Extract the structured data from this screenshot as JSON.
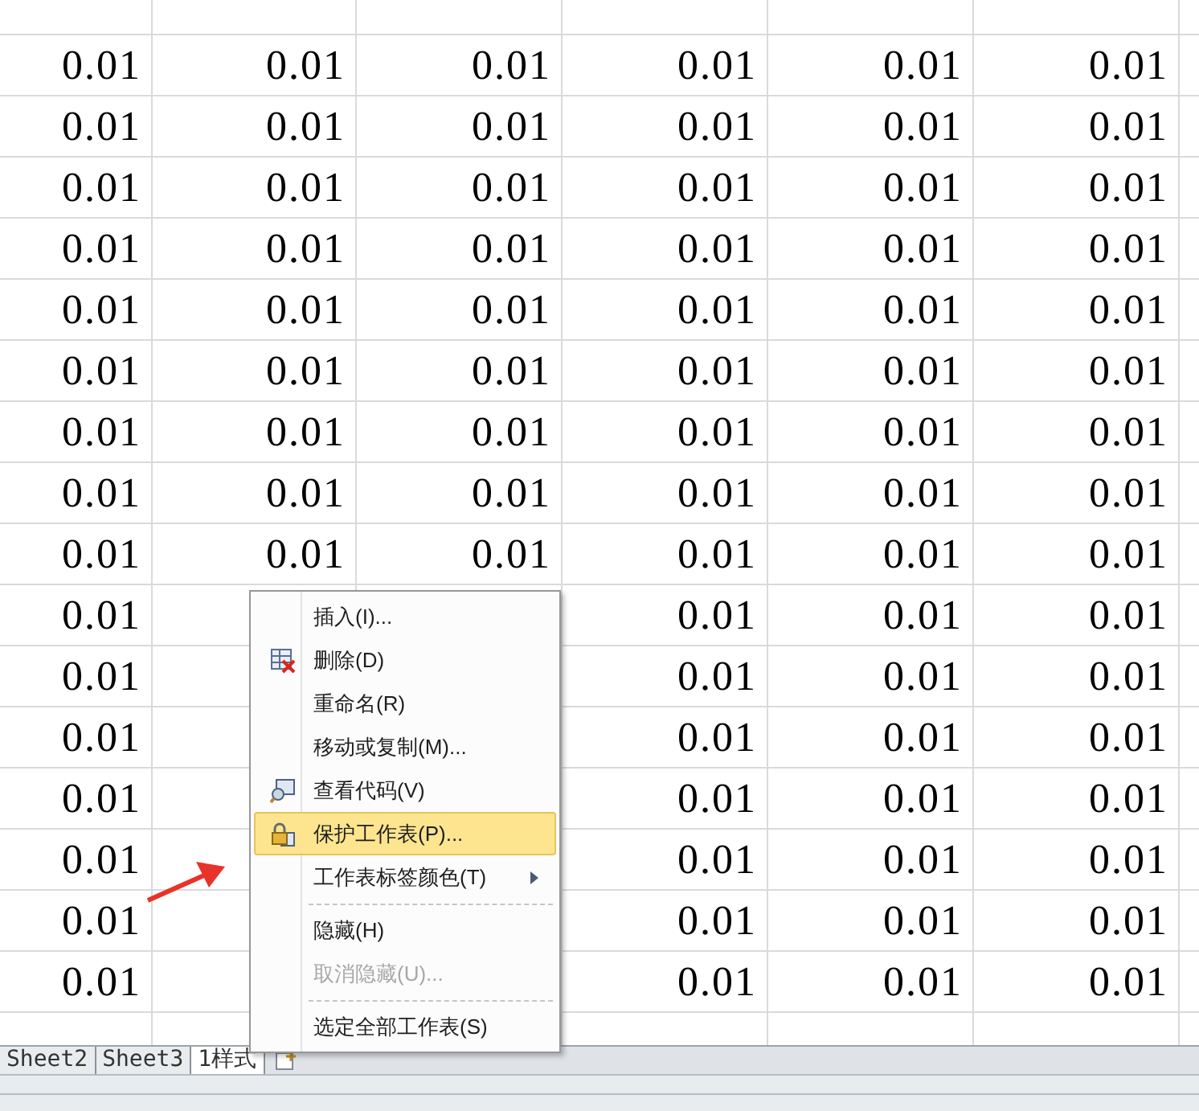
{
  "sheet": {
    "rows": [
      {
        "cells": [
          "0.01",
          "0.01",
          "0.01",
          "0.01",
          "0.01",
          "0.01"
        ]
      },
      {
        "cells": [
          "0.01",
          "0.01",
          "0.01",
          "0.01",
          "0.01",
          "0.01"
        ]
      },
      {
        "cells": [
          "0.01",
          "0.01",
          "0.01",
          "0.01",
          "0.01",
          "0.01"
        ]
      },
      {
        "cells": [
          "0.01",
          "0.01",
          "0.01",
          "0.01",
          "0.01",
          "0.01"
        ]
      },
      {
        "cells": [
          "0.01",
          "0.01",
          "0.01",
          "0.01",
          "0.01",
          "0.01"
        ]
      },
      {
        "cells": [
          "0.01",
          "0.01",
          "0.01",
          "0.01",
          "0.01",
          "0.01"
        ]
      },
      {
        "cells": [
          "0.01",
          "0.01",
          "0.01",
          "0.01",
          "0.01",
          "0.01"
        ]
      },
      {
        "cells": [
          "0.01",
          "0.01",
          "0.01",
          "0.01",
          "0.01",
          "0.01"
        ]
      },
      {
        "cells": [
          "0.01",
          "0.01",
          "0.01",
          "0.01",
          "0.01",
          "0.01"
        ]
      },
      {
        "cells": [
          "0.01",
          null,
          null,
          "0.01",
          "0.01",
          "0.01"
        ]
      },
      {
        "cells": [
          "0.01",
          null,
          null,
          "0.01",
          "0.01",
          "0.01"
        ]
      },
      {
        "cells": [
          "0.01",
          null,
          null,
          "0.01",
          "0.01",
          "0.01"
        ]
      },
      {
        "cells": [
          "0.01",
          null,
          null,
          "0.01",
          "0.01",
          "0.01"
        ]
      },
      {
        "cells": [
          "0.01",
          null,
          null,
          "0.01",
          "0.01",
          "0.01"
        ]
      },
      {
        "cells": [
          "0.01",
          null,
          null,
          "0.01",
          "0.01",
          "0.01"
        ]
      },
      {
        "cells": [
          "0.01",
          null,
          null,
          "0.01",
          "0.01",
          "0.01"
        ]
      }
    ]
  },
  "sheet_tabs": [
    {
      "label": "Sheet2",
      "selected": false
    },
    {
      "label": "Sheet3",
      "selected": false
    },
    {
      "label": "1样式",
      "selected": true
    }
  ],
  "context_menu": {
    "items": [
      {
        "kind": "item",
        "label": "插入(I)...",
        "disabled": false,
        "highlighted": false,
        "submenu": false
      },
      {
        "kind": "item",
        "label": "删除(D)",
        "disabled": false,
        "highlighted": false,
        "submenu": false
      },
      {
        "kind": "item",
        "label": "重命名(R)",
        "disabled": false,
        "highlighted": false,
        "submenu": false
      },
      {
        "kind": "item",
        "label": "移动或复制(M)...",
        "disabled": false,
        "highlighted": false,
        "submenu": false
      },
      {
        "kind": "item",
        "label": "查看代码(V)",
        "disabled": false,
        "highlighted": false,
        "submenu": false
      },
      {
        "kind": "item",
        "label": "保护工作表(P)...",
        "disabled": false,
        "highlighted": true,
        "submenu": false
      },
      {
        "kind": "item",
        "label": "工作表标签颜色(T)",
        "submenu": true,
        "disabled": false,
        "highlighted": false
      },
      {
        "kind": "separator"
      },
      {
        "kind": "item",
        "label": "隐藏(H)",
        "disabled": false,
        "highlighted": false,
        "submenu": false
      },
      {
        "kind": "item",
        "label": "取消隐藏(U)...",
        "disabled": true,
        "highlighted": false,
        "submenu": false
      },
      {
        "kind": "separator"
      },
      {
        "kind": "item",
        "label": "选定全部工作表(S)",
        "disabled": false,
        "highlighted": false,
        "submenu": false
      }
    ]
  }
}
